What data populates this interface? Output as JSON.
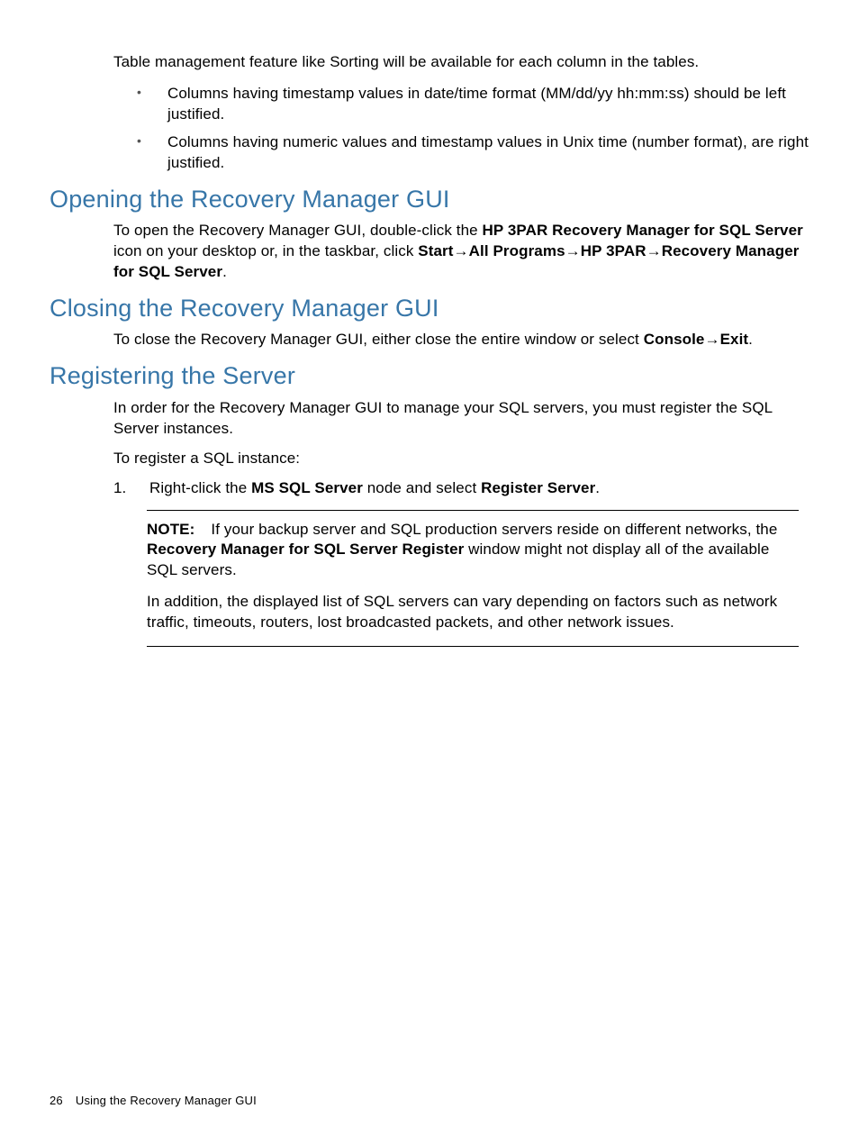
{
  "intro": "Table management feature like Sorting will be available for each column in the tables.",
  "bullets": [
    "Columns having timestamp values in date/time format (MM/dd/yy hh:mm:ss) should be left justified.",
    "Columns having numeric values and timestamp values in Unix time (number format), are right justified."
  ],
  "section_opening": {
    "heading": "Opening the Recovery Manager GUI",
    "p1_pre": "To open the Recovery Manager GUI, double-click the ",
    "p1_b1": "HP 3PAR Recovery Manager for SQL Server",
    "p1_mid": " icon on your desktop or, in the taskbar, click ",
    "p1_b2": "Start",
    "p1_b3": "All Programs",
    "p1_b4": "HP 3PAR",
    "p1_b5": "Recovery Manager for SQL Server",
    "p1_end": "."
  },
  "section_closing": {
    "heading": "Closing the Recovery Manager GUI",
    "p1_pre": "To close the Recovery Manager GUI, either close the entire window or select ",
    "p1_b1": "Console",
    "p1_b2": "Exit",
    "p1_end": "."
  },
  "section_register": {
    "heading": "Registering the Server",
    "p1": "In order for the Recovery Manager GUI to manage your SQL servers, you must register the SQL Server instances.",
    "p2": "To register a SQL instance:",
    "step1_num": "1.",
    "step1_pre": "Right-click the ",
    "step1_b1": "MS SQL Server",
    "step1_mid": " node and select ",
    "step1_b2": "Register Server",
    "step1_end": ".",
    "note_label": "NOTE:",
    "note_p1_pre": "If your backup server and SQL production servers reside on different networks, the ",
    "note_p1_b": "Recovery Manager for SQL Server Register",
    "note_p1_end": " window might not display all of the available SQL servers.",
    "note_p2": "In addition, the displayed list of SQL servers can vary depending on factors such as network traffic, timeouts, routers, lost broadcasted packets, and other network issues."
  },
  "footer": {
    "page": "26",
    "title": "Using the Recovery Manager GUI"
  },
  "arrow": "→"
}
